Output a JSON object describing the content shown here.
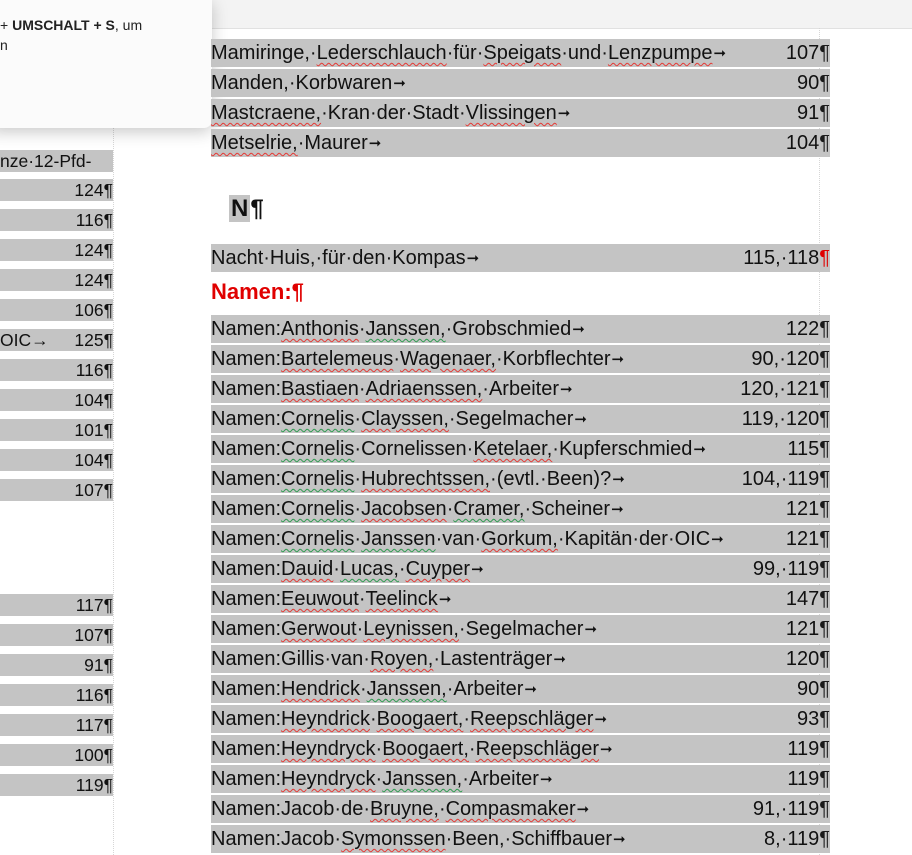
{
  "tooltip": {
    "line1": "+ UMSCHALT + S, um",
    "line2": "n"
  },
  "left_column": {
    "first_line": "nze·12-Pfd-",
    "rows": [
      {
        "text": "",
        "num": "124¶"
      },
      {
        "text": "",
        "num": "116¶"
      },
      {
        "text": "",
        "num": "124¶"
      },
      {
        "text": "",
        "num": "124¶"
      },
      {
        "text": "",
        "num": "106¶"
      },
      {
        "text": "OIC→",
        "num": "125¶"
      },
      {
        "text": "",
        "num": "116¶"
      },
      {
        "text": "",
        "num": "104¶"
      },
      {
        "text": "",
        "num": "101¶"
      },
      {
        "text": "",
        "num": "104¶"
      },
      {
        "text": "",
        "num": "107¶"
      }
    ],
    "rows2": [
      {
        "text": "",
        "num": "117¶"
      },
      {
        "text": "",
        "num": "107¶"
      },
      {
        "text": "",
        "num": "91¶"
      },
      {
        "text": "",
        "num": "116¶"
      },
      {
        "text": "",
        "num": "117¶"
      },
      {
        "text": "",
        "num": "100¶"
      },
      {
        "text": "",
        "num": "119¶"
      }
    ]
  },
  "main": {
    "m_entries": [
      {
        "text": "Mamiringe,·Lederschlauch·für·Speigats·und·Lenzpumpe",
        "num": "107",
        "mark": "¶"
      },
      {
        "text": "Manden,·Korbwaren",
        "num": "90",
        "mark": "¶"
      },
      {
        "text": "Mastcraene,·Kran·der·Stadt·Vlissingen",
        "num": "91",
        "mark": "¶"
      },
      {
        "text": "Metselrie,·Maurer",
        "num": "104",
        "mark": "¶"
      }
    ],
    "heading_letter": "N",
    "heading_mark": "¶",
    "nacht": {
      "text": "Nacht·Huis,·für·den·Kompas",
      "num": "115,·118",
      "mark": "¶"
    },
    "namen_heading": "Namen:¶",
    "namen_entries": [
      {
        "prefix": "Namen:",
        "text": "Anthonis·Janssen,·Grobschmied",
        "num": "122",
        "mark": "¶"
      },
      {
        "prefix": "Namen:",
        "text": "Bartelemeus·Wagenaer,·Korbflechter",
        "num": "90,·120",
        "mark": "¶"
      },
      {
        "prefix": "Namen:",
        "text": "Bastiaen·Adriaenssen,·Arbeiter",
        "num": "120,·121",
        "mark": "¶"
      },
      {
        "prefix": "Namen:",
        "text": "Cornelis·Clayssen,·Segelmacher",
        "num": "119,·120",
        "mark": "¶"
      },
      {
        "prefix": "Namen:",
        "text": "Cornelis·Cornelissen·Ketelaer,·Kupferschmied",
        "num": "115",
        "mark": "¶"
      },
      {
        "prefix": "Namen:",
        "text": "Cornelis·Hubrechtssen,·(evtl.·Been)?",
        "num": "104,·119",
        "mark": "¶"
      },
      {
        "prefix": "Namen:",
        "text": "Cornelis·Jacobsen·Cramer,·Scheiner",
        "num": "121",
        "mark": "¶"
      },
      {
        "prefix": "Namen:",
        "text": "Cornelis·Janssen·van·Gorkum,·Kapitän·der·OIC",
        "num": "121",
        "mark": "¶"
      },
      {
        "prefix": "Namen:",
        "text": "Dauid·Lucas,·Cuyper",
        "num": "99,·119",
        "mark": "¶"
      },
      {
        "prefix": "Namen:",
        "text": "Eeuwout·Teelinck",
        "num": "147",
        "mark": "¶"
      },
      {
        "prefix": "Namen:",
        "text": "Gerwout·Leynissen,·Segelmacher",
        "num": "121",
        "mark": "¶"
      },
      {
        "prefix": "Namen:",
        "text": "Gillis·van·Royen,·Lastenträger",
        "num": "120",
        "mark": "¶"
      },
      {
        "prefix": "Namen:",
        "text": "Hendrick·Janssen,·Arbeiter",
        "num": "90",
        "mark": "¶"
      },
      {
        "prefix": "Namen:",
        "text": "Heyndrick·Boogaert,·Reepschläger",
        "num": "93",
        "mark": "¶"
      },
      {
        "prefix": "Namen:",
        "text": "Heyndryck·Boogaert,·Reepschläger",
        "num": "119",
        "mark": "¶"
      },
      {
        "prefix": "Namen:",
        "text": "Heyndryck·Janssen,·Arbeiter",
        "num": "119",
        "mark": "¶"
      },
      {
        "prefix": "Namen:",
        "text": "Jacob·de·Bruyne,·Compasmaker",
        "num": "91,·119",
        "mark": "¶"
      },
      {
        "prefix": "Namen:",
        "text": "Jacob·Symonssen·Been,·Schiffbauer",
        "num": "8,·119",
        "mark": "¶"
      }
    ],
    "tab_arrow": "➞"
  }
}
